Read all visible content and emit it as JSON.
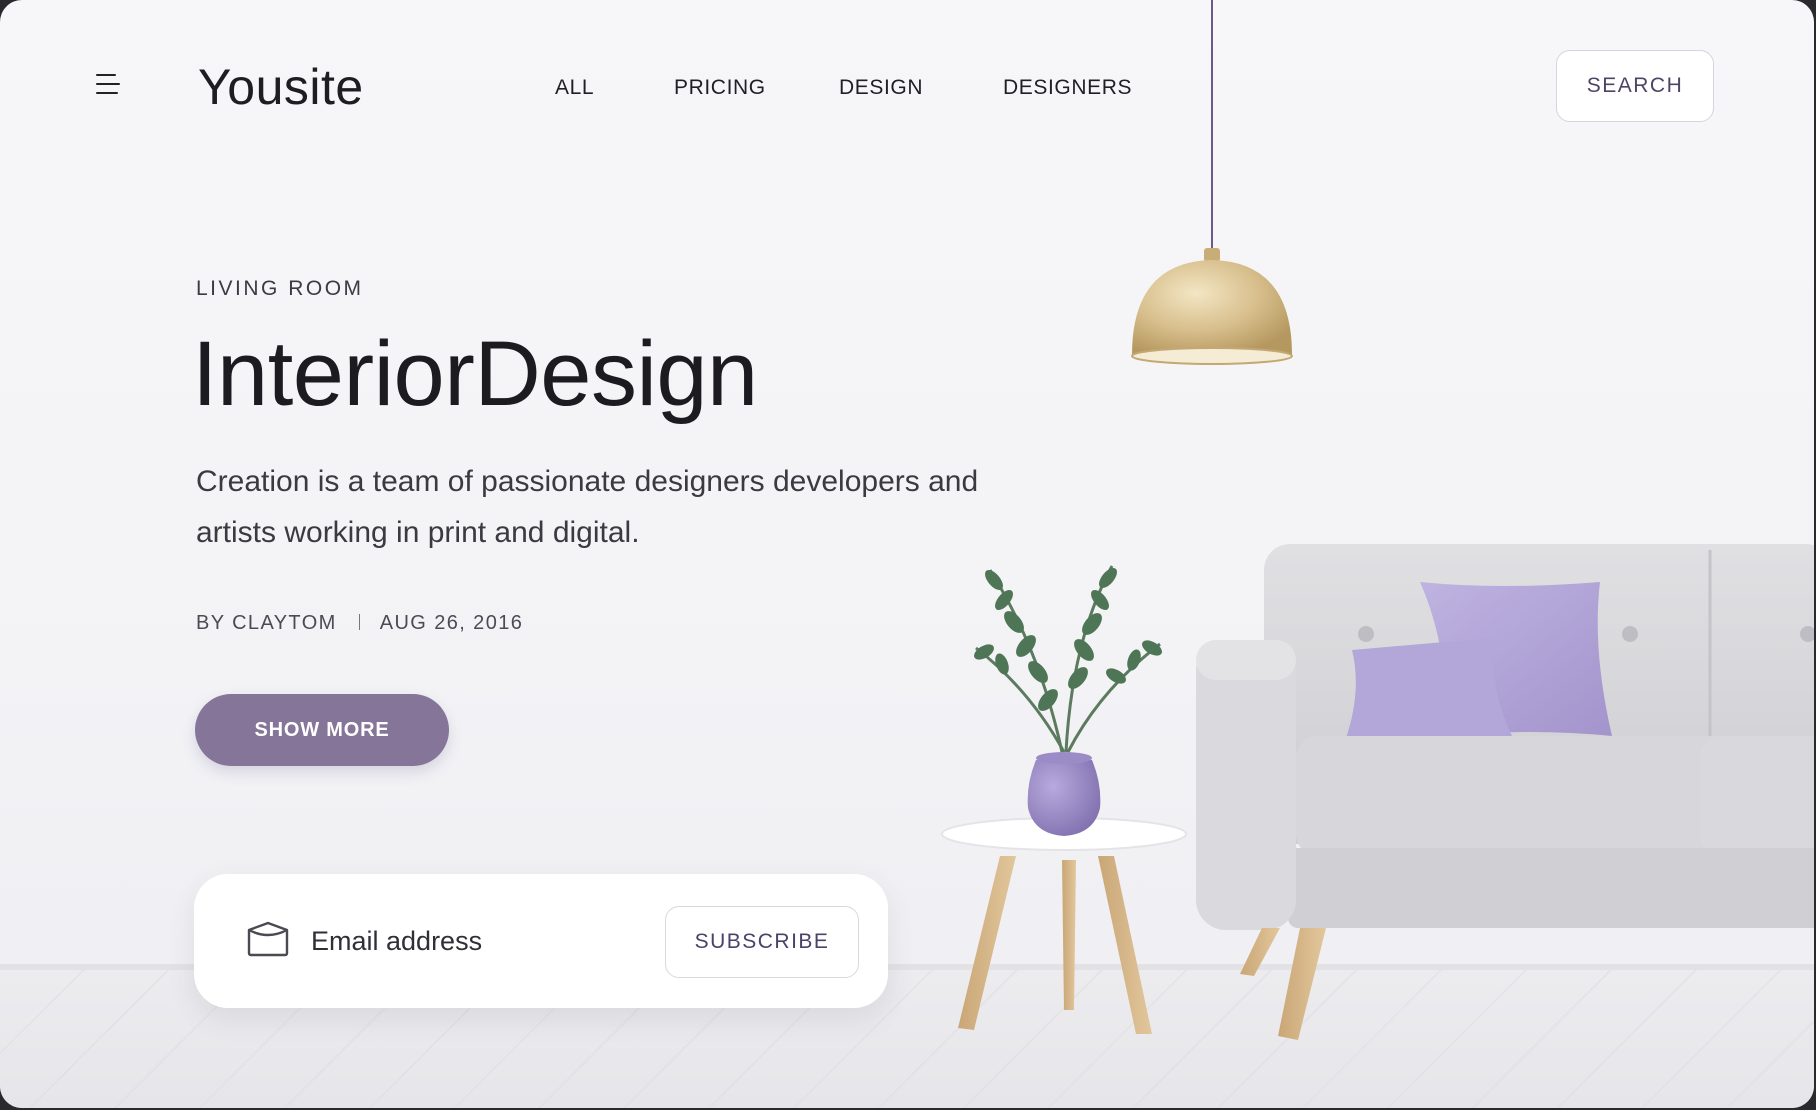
{
  "header": {
    "logo": "Yousite",
    "nav": [
      "ALL",
      "PRICING",
      "DESIGN",
      "DESIGNERS"
    ],
    "search_label": "SEARCH"
  },
  "hero": {
    "kicker": "LIVING ROOM",
    "headline": "InteriorDesign",
    "description": "Creation is a team of passionate designers developers and artists working in print and digital.",
    "author": "BY CLAYTOM",
    "date": "AUG 26, 2016",
    "show_more_label": "SHOW MORE"
  },
  "subscribe": {
    "email_placeholder": "Email address",
    "button_label": "SUBSCRIBE"
  },
  "icons": {
    "menu": "hamburger-icon",
    "mail": "envelope-icon"
  },
  "colors": {
    "accent": "#857599",
    "accent_text": "#4b416a",
    "lamp": "#d2b888",
    "cushion": "#b1a4d6",
    "sofa": "#d8d8dc"
  }
}
